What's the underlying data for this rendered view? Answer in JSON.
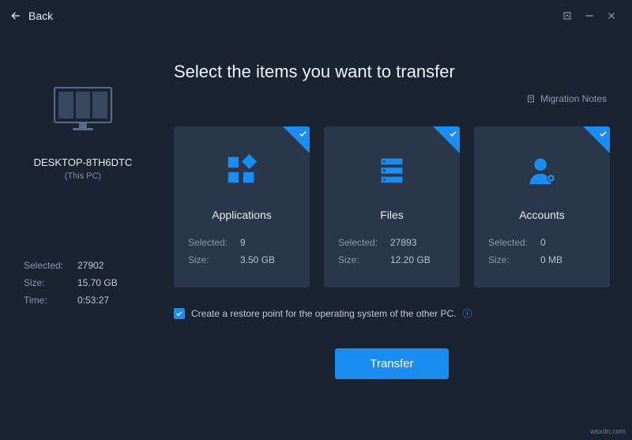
{
  "titlebar": {
    "back_label": "Back"
  },
  "sidebar": {
    "pc_name": "DESKTOP-8TH6DTC",
    "pc_sub": "(This PC)",
    "stats": {
      "selected_label": "Selected:",
      "selected_value": "27902",
      "size_label": "Size:",
      "size_value": "15.70 GB",
      "time_label": "Time:",
      "time_value": "0:53:27"
    }
  },
  "main": {
    "heading": "Select the items you want to transfer",
    "migration_notes": "Migration Notes",
    "cards": {
      "applications": {
        "title": "Applications",
        "selected_label": "Selected:",
        "selected_value": "9",
        "size_label": "Size:",
        "size_value": "3.50 GB"
      },
      "files": {
        "title": "Files",
        "selected_label": "Selected:",
        "selected_value": "27893",
        "size_label": "Size:",
        "size_value": "12.20 GB"
      },
      "accounts": {
        "title": "Accounts",
        "selected_label": "Selected:",
        "selected_value": "0",
        "size_label": "Size:",
        "size_value": "0 MB"
      }
    },
    "restore_text": "Create a restore point for the operating system of the other PC.",
    "transfer_label": "Transfer"
  },
  "watermark": "wsxdn.com"
}
